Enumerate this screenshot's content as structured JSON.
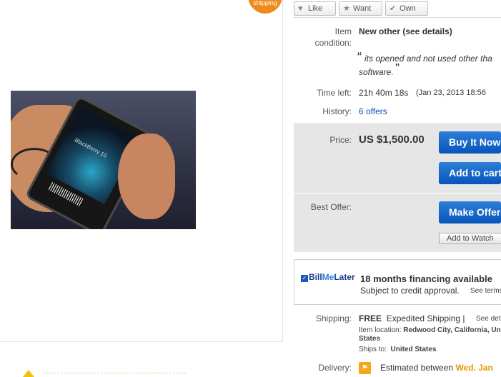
{
  "badge": {
    "text": "shipping"
  },
  "social": {
    "like": "Like",
    "want": "Want",
    "own": "Own"
  },
  "condition": {
    "label_1": "Item",
    "label_2": "condition:",
    "value": "New other (see details)",
    "quote_open": "“",
    "quote_line1": "its opened and not used other tha",
    "quote_line2": "software.",
    "quote_close": "”"
  },
  "time_left": {
    "label": "Time left:",
    "value": "21h 40m 18s",
    "end": "(Jan 23, 2013   18:56"
  },
  "history": {
    "label": "History:",
    "value": "6 offers"
  },
  "price": {
    "label": "Price:",
    "value": "US $1,500.00"
  },
  "buttons": {
    "buy_now": "Buy It Now",
    "add_to_cart": "Add to cart",
    "make_offer": "Make Offer",
    "add_to_watch": "Add to Watch"
  },
  "best_offer": {
    "label": "Best Offer:"
  },
  "billmelater": {
    "logo_bill": "Bill",
    "logo_me": "Me",
    "logo_later": "Later",
    "headline": "18 months financing available",
    "subtext": "Subject to credit approval.",
    "see_terms": "See terms"
  },
  "shipping": {
    "label": "Shipping:",
    "free": "FREE",
    "method": "Expedited Shipping |",
    "see_details": "See details",
    "item_location_label": "Item location:",
    "item_location": "Redwood City, California, United",
    "item_location_cont": "States",
    "ships_to_label": "Ships to:",
    "ships_to": "United States"
  },
  "delivery": {
    "label": "Delivery:",
    "text": "Estimated between",
    "date": "Wed. Jan"
  },
  "photo": {
    "caption": "BlackBerry 10"
  }
}
